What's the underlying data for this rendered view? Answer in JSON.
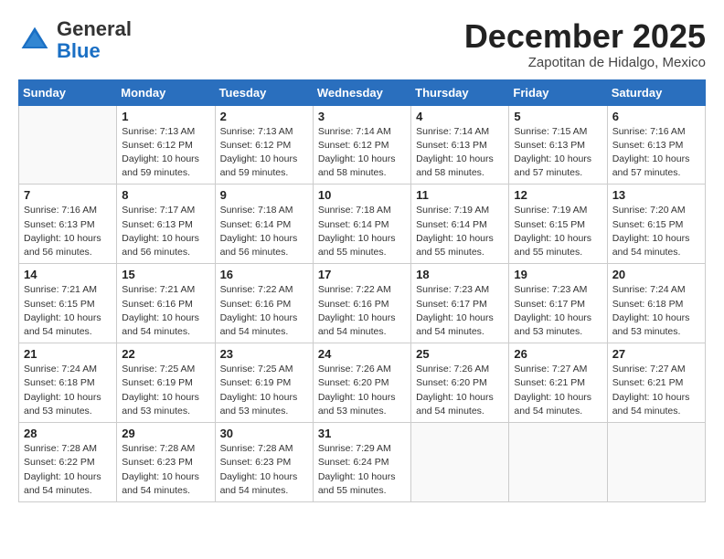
{
  "header": {
    "logo_general": "General",
    "logo_blue": "Blue",
    "month_title": "December 2025",
    "location": "Zapotitan de Hidalgo, Mexico"
  },
  "columns": [
    "Sunday",
    "Monday",
    "Tuesday",
    "Wednesday",
    "Thursday",
    "Friday",
    "Saturday"
  ],
  "weeks": [
    [
      {
        "day": "",
        "info": ""
      },
      {
        "day": "1",
        "info": "Sunrise: 7:13 AM\nSunset: 6:12 PM\nDaylight: 10 hours\nand 59 minutes."
      },
      {
        "day": "2",
        "info": "Sunrise: 7:13 AM\nSunset: 6:12 PM\nDaylight: 10 hours\nand 59 minutes."
      },
      {
        "day": "3",
        "info": "Sunrise: 7:14 AM\nSunset: 6:12 PM\nDaylight: 10 hours\nand 58 minutes."
      },
      {
        "day": "4",
        "info": "Sunrise: 7:14 AM\nSunset: 6:13 PM\nDaylight: 10 hours\nand 58 minutes."
      },
      {
        "day": "5",
        "info": "Sunrise: 7:15 AM\nSunset: 6:13 PM\nDaylight: 10 hours\nand 57 minutes."
      },
      {
        "day": "6",
        "info": "Sunrise: 7:16 AM\nSunset: 6:13 PM\nDaylight: 10 hours\nand 57 minutes."
      }
    ],
    [
      {
        "day": "7",
        "info": "Sunrise: 7:16 AM\nSunset: 6:13 PM\nDaylight: 10 hours\nand 56 minutes."
      },
      {
        "day": "8",
        "info": "Sunrise: 7:17 AM\nSunset: 6:13 PM\nDaylight: 10 hours\nand 56 minutes."
      },
      {
        "day": "9",
        "info": "Sunrise: 7:18 AM\nSunset: 6:14 PM\nDaylight: 10 hours\nand 56 minutes."
      },
      {
        "day": "10",
        "info": "Sunrise: 7:18 AM\nSunset: 6:14 PM\nDaylight: 10 hours\nand 55 minutes."
      },
      {
        "day": "11",
        "info": "Sunrise: 7:19 AM\nSunset: 6:14 PM\nDaylight: 10 hours\nand 55 minutes."
      },
      {
        "day": "12",
        "info": "Sunrise: 7:19 AM\nSunset: 6:15 PM\nDaylight: 10 hours\nand 55 minutes."
      },
      {
        "day": "13",
        "info": "Sunrise: 7:20 AM\nSunset: 6:15 PM\nDaylight: 10 hours\nand 54 minutes."
      }
    ],
    [
      {
        "day": "14",
        "info": "Sunrise: 7:21 AM\nSunset: 6:15 PM\nDaylight: 10 hours\nand 54 minutes."
      },
      {
        "day": "15",
        "info": "Sunrise: 7:21 AM\nSunset: 6:16 PM\nDaylight: 10 hours\nand 54 minutes."
      },
      {
        "day": "16",
        "info": "Sunrise: 7:22 AM\nSunset: 6:16 PM\nDaylight: 10 hours\nand 54 minutes."
      },
      {
        "day": "17",
        "info": "Sunrise: 7:22 AM\nSunset: 6:16 PM\nDaylight: 10 hours\nand 54 minutes."
      },
      {
        "day": "18",
        "info": "Sunrise: 7:23 AM\nSunset: 6:17 PM\nDaylight: 10 hours\nand 54 minutes."
      },
      {
        "day": "19",
        "info": "Sunrise: 7:23 AM\nSunset: 6:17 PM\nDaylight: 10 hours\nand 53 minutes."
      },
      {
        "day": "20",
        "info": "Sunrise: 7:24 AM\nSunset: 6:18 PM\nDaylight: 10 hours\nand 53 minutes."
      }
    ],
    [
      {
        "day": "21",
        "info": "Sunrise: 7:24 AM\nSunset: 6:18 PM\nDaylight: 10 hours\nand 53 minutes."
      },
      {
        "day": "22",
        "info": "Sunrise: 7:25 AM\nSunset: 6:19 PM\nDaylight: 10 hours\nand 53 minutes."
      },
      {
        "day": "23",
        "info": "Sunrise: 7:25 AM\nSunset: 6:19 PM\nDaylight: 10 hours\nand 53 minutes."
      },
      {
        "day": "24",
        "info": "Sunrise: 7:26 AM\nSunset: 6:20 PM\nDaylight: 10 hours\nand 53 minutes."
      },
      {
        "day": "25",
        "info": "Sunrise: 7:26 AM\nSunset: 6:20 PM\nDaylight: 10 hours\nand 54 minutes."
      },
      {
        "day": "26",
        "info": "Sunrise: 7:27 AM\nSunset: 6:21 PM\nDaylight: 10 hours\nand 54 minutes."
      },
      {
        "day": "27",
        "info": "Sunrise: 7:27 AM\nSunset: 6:21 PM\nDaylight: 10 hours\nand 54 minutes."
      }
    ],
    [
      {
        "day": "28",
        "info": "Sunrise: 7:28 AM\nSunset: 6:22 PM\nDaylight: 10 hours\nand 54 minutes."
      },
      {
        "day": "29",
        "info": "Sunrise: 7:28 AM\nSunset: 6:23 PM\nDaylight: 10 hours\nand 54 minutes."
      },
      {
        "day": "30",
        "info": "Sunrise: 7:28 AM\nSunset: 6:23 PM\nDaylight: 10 hours\nand 54 minutes."
      },
      {
        "day": "31",
        "info": "Sunrise: 7:29 AM\nSunset: 6:24 PM\nDaylight: 10 hours\nand 55 minutes."
      },
      {
        "day": "",
        "info": ""
      },
      {
        "day": "",
        "info": ""
      },
      {
        "day": "",
        "info": ""
      }
    ]
  ]
}
